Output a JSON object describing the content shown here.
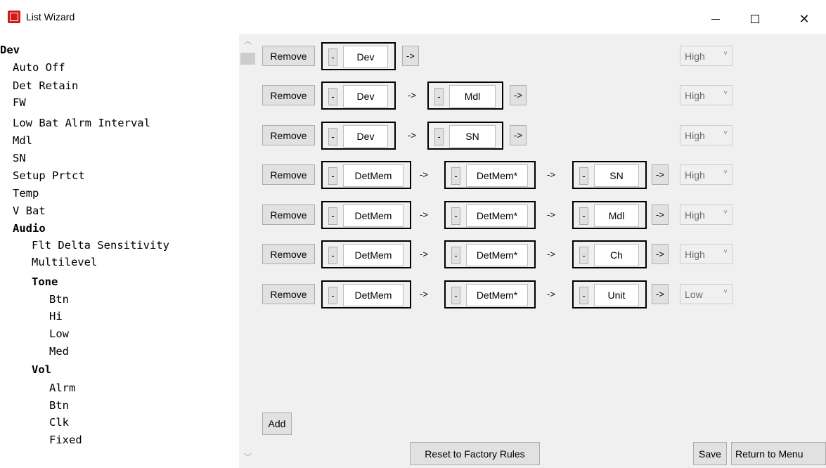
{
  "window": {
    "title": "List Wizard"
  },
  "tree": [
    {
      "label": "Dev",
      "bold": true
    },
    {
      "label": "Auto Off",
      "bold": false
    },
    {
      "label": "Det Retain",
      "bold": false
    },
    {
      "label": "FW",
      "bold": false
    },
    {
      "label": "Low Bat Alrm Interval",
      "bold": false
    },
    {
      "label": "Mdl",
      "bold": false
    },
    {
      "label": "SN",
      "bold": false
    },
    {
      "label": "Setup Prtct",
      "bold": false
    },
    {
      "label": "Temp",
      "bold": false
    },
    {
      "label": "V Bat",
      "bold": false
    },
    {
      "label": "Audio",
      "bold": true
    },
    {
      "label": "Flt Delta Sensitivity",
      "bold": false
    },
    {
      "label": "Multilevel",
      "bold": false
    },
    {
      "label": "Tone",
      "bold": true
    },
    {
      "label": "Btn",
      "bold": false
    },
    {
      "label": "Hi",
      "bold": false
    },
    {
      "label": "Low",
      "bold": false
    },
    {
      "label": "Med",
      "bold": false
    },
    {
      "label": "Vol",
      "bold": true
    },
    {
      "label": "Alrm",
      "bold": false
    },
    {
      "label": "Btn",
      "bold": false
    },
    {
      "label": "Clk",
      "bold": false
    },
    {
      "label": "Fixed",
      "bold": false
    }
  ],
  "rules": [
    {
      "remove": "Remove",
      "segments": [
        "Dev"
      ],
      "priority": "High"
    },
    {
      "remove": "Remove",
      "segments": [
        "Dev",
        "Mdl"
      ],
      "priority": "High"
    },
    {
      "remove": "Remove",
      "segments": [
        "Dev",
        "SN"
      ],
      "priority": "High"
    },
    {
      "remove": "Remove",
      "segments": [
        "DetMem",
        "DetMem*",
        "SN"
      ],
      "priority": "High"
    },
    {
      "remove": "Remove",
      "segments": [
        "DetMem",
        "DetMem*",
        "Mdl"
      ],
      "priority": "High"
    },
    {
      "remove": "Remove",
      "segments": [
        "DetMem",
        "DetMem*",
        "Ch"
      ],
      "priority": "High"
    },
    {
      "remove": "Remove",
      "segments": [
        "DetMem",
        "DetMem*",
        "Unit"
      ],
      "priority": "Low"
    }
  ],
  "labels": {
    "minus": "-",
    "arrow": "->",
    "add": "Add",
    "reset": "Reset to Factory Rules",
    "save": "Save",
    "return": "Return to Menu"
  }
}
